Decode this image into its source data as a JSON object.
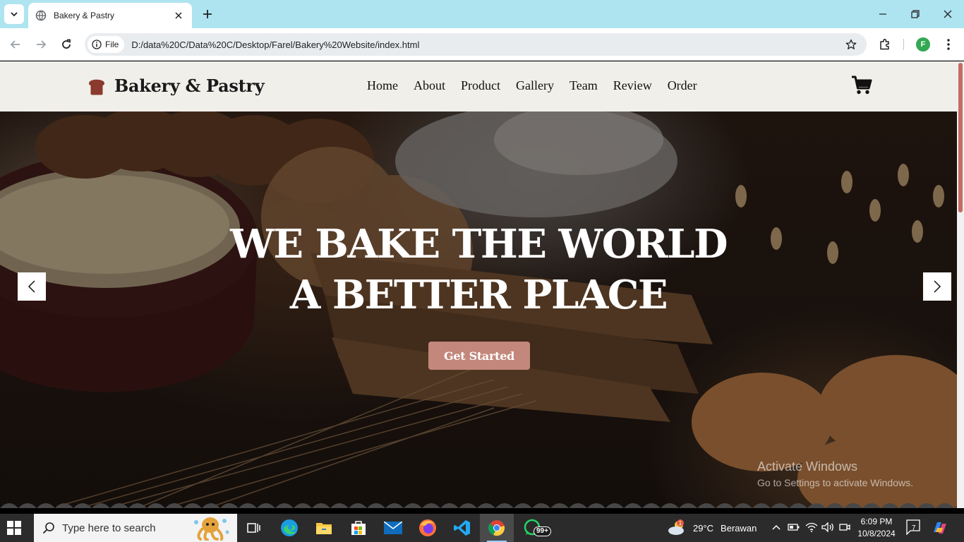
{
  "browser": {
    "tab_title": "Bakery & Pastry",
    "site_chip": "File",
    "url": "D:/data%20C/Data%20C/Desktop/Farel/Bakery%20Website/index.html",
    "profile_initial": "F"
  },
  "site": {
    "brand": "Bakery & Pastry",
    "nav": [
      "Home",
      "About",
      "Product",
      "Gallery",
      "Team",
      "Review",
      "Order"
    ],
    "hero_title": "WE BAKE THE WORLD A BETTER PLACE",
    "cta_label": "Get Started",
    "accent_color": "#c3877b",
    "logo_color": "#8b3a2e"
  },
  "watermark": {
    "title": "Activate Windows",
    "subtitle": "Go to Settings to activate Windows."
  },
  "taskbar": {
    "search_placeholder": "Type here to search",
    "whatsapp_badge": "99+",
    "weather_temp": "29°C",
    "weather_desc": "Berawan",
    "time": "6:09 PM",
    "date": "10/8/2024",
    "notification_count": "7",
    "weather_alert": "1"
  }
}
